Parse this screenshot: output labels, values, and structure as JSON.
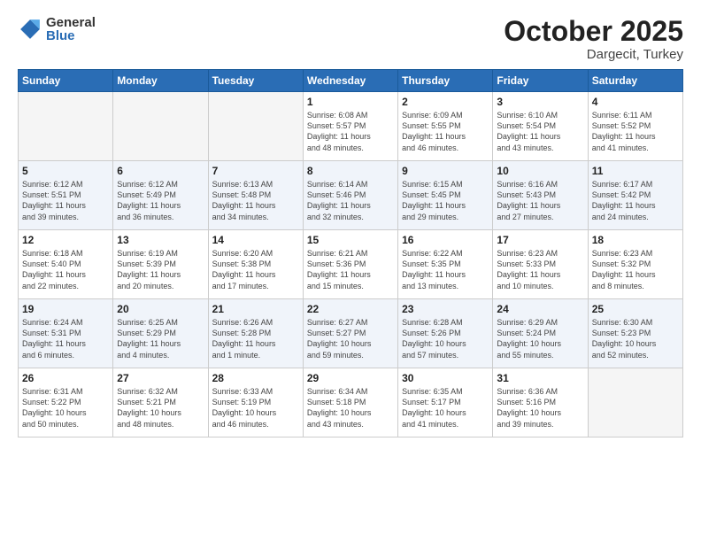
{
  "logo": {
    "general": "General",
    "blue": "Blue"
  },
  "header": {
    "month": "October 2025",
    "location": "Dargecit, Turkey"
  },
  "weekdays": [
    "Sunday",
    "Monday",
    "Tuesday",
    "Wednesday",
    "Thursday",
    "Friday",
    "Saturday"
  ],
  "weeks": [
    [
      {
        "day": "",
        "info": ""
      },
      {
        "day": "",
        "info": ""
      },
      {
        "day": "",
        "info": ""
      },
      {
        "day": "1",
        "info": "Sunrise: 6:08 AM\nSunset: 5:57 PM\nDaylight: 11 hours\nand 48 minutes."
      },
      {
        "day": "2",
        "info": "Sunrise: 6:09 AM\nSunset: 5:55 PM\nDaylight: 11 hours\nand 46 minutes."
      },
      {
        "day": "3",
        "info": "Sunrise: 6:10 AM\nSunset: 5:54 PM\nDaylight: 11 hours\nand 43 minutes."
      },
      {
        "day": "4",
        "info": "Sunrise: 6:11 AM\nSunset: 5:52 PM\nDaylight: 11 hours\nand 41 minutes."
      }
    ],
    [
      {
        "day": "5",
        "info": "Sunrise: 6:12 AM\nSunset: 5:51 PM\nDaylight: 11 hours\nand 39 minutes."
      },
      {
        "day": "6",
        "info": "Sunrise: 6:12 AM\nSunset: 5:49 PM\nDaylight: 11 hours\nand 36 minutes."
      },
      {
        "day": "7",
        "info": "Sunrise: 6:13 AM\nSunset: 5:48 PM\nDaylight: 11 hours\nand 34 minutes."
      },
      {
        "day": "8",
        "info": "Sunrise: 6:14 AM\nSunset: 5:46 PM\nDaylight: 11 hours\nand 32 minutes."
      },
      {
        "day": "9",
        "info": "Sunrise: 6:15 AM\nSunset: 5:45 PM\nDaylight: 11 hours\nand 29 minutes."
      },
      {
        "day": "10",
        "info": "Sunrise: 6:16 AM\nSunset: 5:43 PM\nDaylight: 11 hours\nand 27 minutes."
      },
      {
        "day": "11",
        "info": "Sunrise: 6:17 AM\nSunset: 5:42 PM\nDaylight: 11 hours\nand 24 minutes."
      }
    ],
    [
      {
        "day": "12",
        "info": "Sunrise: 6:18 AM\nSunset: 5:40 PM\nDaylight: 11 hours\nand 22 minutes."
      },
      {
        "day": "13",
        "info": "Sunrise: 6:19 AM\nSunset: 5:39 PM\nDaylight: 11 hours\nand 20 minutes."
      },
      {
        "day": "14",
        "info": "Sunrise: 6:20 AM\nSunset: 5:38 PM\nDaylight: 11 hours\nand 17 minutes."
      },
      {
        "day": "15",
        "info": "Sunrise: 6:21 AM\nSunset: 5:36 PM\nDaylight: 11 hours\nand 15 minutes."
      },
      {
        "day": "16",
        "info": "Sunrise: 6:22 AM\nSunset: 5:35 PM\nDaylight: 11 hours\nand 13 minutes."
      },
      {
        "day": "17",
        "info": "Sunrise: 6:23 AM\nSunset: 5:33 PM\nDaylight: 11 hours\nand 10 minutes."
      },
      {
        "day": "18",
        "info": "Sunrise: 6:23 AM\nSunset: 5:32 PM\nDaylight: 11 hours\nand 8 minutes."
      }
    ],
    [
      {
        "day": "19",
        "info": "Sunrise: 6:24 AM\nSunset: 5:31 PM\nDaylight: 11 hours\nand 6 minutes."
      },
      {
        "day": "20",
        "info": "Sunrise: 6:25 AM\nSunset: 5:29 PM\nDaylight: 11 hours\nand 4 minutes."
      },
      {
        "day": "21",
        "info": "Sunrise: 6:26 AM\nSunset: 5:28 PM\nDaylight: 11 hours\nand 1 minute."
      },
      {
        "day": "22",
        "info": "Sunrise: 6:27 AM\nSunset: 5:27 PM\nDaylight: 10 hours\nand 59 minutes."
      },
      {
        "day": "23",
        "info": "Sunrise: 6:28 AM\nSunset: 5:26 PM\nDaylight: 10 hours\nand 57 minutes."
      },
      {
        "day": "24",
        "info": "Sunrise: 6:29 AM\nSunset: 5:24 PM\nDaylight: 10 hours\nand 55 minutes."
      },
      {
        "day": "25",
        "info": "Sunrise: 6:30 AM\nSunset: 5:23 PM\nDaylight: 10 hours\nand 52 minutes."
      }
    ],
    [
      {
        "day": "26",
        "info": "Sunrise: 6:31 AM\nSunset: 5:22 PM\nDaylight: 10 hours\nand 50 minutes."
      },
      {
        "day": "27",
        "info": "Sunrise: 6:32 AM\nSunset: 5:21 PM\nDaylight: 10 hours\nand 48 minutes."
      },
      {
        "day": "28",
        "info": "Sunrise: 6:33 AM\nSunset: 5:19 PM\nDaylight: 10 hours\nand 46 minutes."
      },
      {
        "day": "29",
        "info": "Sunrise: 6:34 AM\nSunset: 5:18 PM\nDaylight: 10 hours\nand 43 minutes."
      },
      {
        "day": "30",
        "info": "Sunrise: 6:35 AM\nSunset: 5:17 PM\nDaylight: 10 hours\nand 41 minutes."
      },
      {
        "day": "31",
        "info": "Sunrise: 6:36 AM\nSunset: 5:16 PM\nDaylight: 10 hours\nand 39 minutes."
      },
      {
        "day": "",
        "info": ""
      }
    ]
  ]
}
